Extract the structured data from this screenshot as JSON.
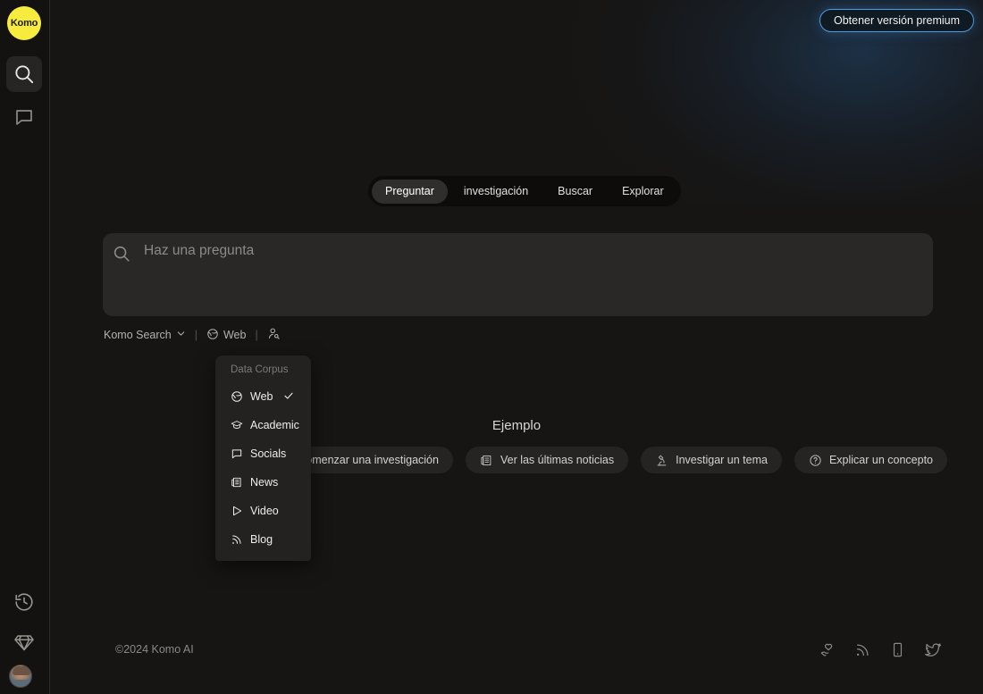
{
  "app": {
    "logo_text": "Komo",
    "copyright": "©2024 Komo AI"
  },
  "colors": {
    "background": "#171513",
    "sidebar": "#131211",
    "searchbox": "#2a2826",
    "accent_yellow": "#f7ec3d",
    "premium_border": "#4c9ddb",
    "dropdown_bg": "#232220"
  },
  "header": {
    "premium_button": "Obtener versión premium"
  },
  "sidebar": {
    "items": [
      {
        "name": "logo",
        "icon": "komo-logo-icon",
        "label": "Komo"
      },
      {
        "name": "search",
        "icon": "search-icon",
        "active": true
      },
      {
        "name": "chat",
        "icon": "chat-bubble-icon",
        "active": false
      },
      {
        "name": "history",
        "icon": "history-clock-icon",
        "active": false
      },
      {
        "name": "premium",
        "icon": "diamond-icon",
        "active": false
      },
      {
        "name": "profile",
        "icon": "avatar-icon",
        "active": false
      }
    ]
  },
  "tabs": [
    {
      "label": "Preguntar",
      "active": true
    },
    {
      "label": "investigación",
      "active": false
    },
    {
      "label": "Buscar",
      "active": false
    },
    {
      "label": "Explorar",
      "active": false
    }
  ],
  "search": {
    "placeholder": "Haz una pregunta",
    "value": "",
    "icon": "search-icon"
  },
  "controls": {
    "engine_label": "Komo Search",
    "engine_chevron": "chevron-down-icon",
    "divider": "|",
    "corpus_label": "Web",
    "corpus_icon": "globe-icon",
    "persona_icon": "person-search-icon"
  },
  "dropdown": {
    "title": "Data Corpus",
    "items": [
      {
        "label": "Web",
        "icon": "globe-icon",
        "selected": true
      },
      {
        "label": "Academic",
        "icon": "graduation-cap-icon",
        "selected": false
      },
      {
        "label": "Socials",
        "icon": "chat-bubble-icon",
        "selected": false
      },
      {
        "label": "News",
        "icon": "newspaper-icon",
        "selected": false
      },
      {
        "label": "Video",
        "icon": "play-triangle-icon",
        "selected": false
      },
      {
        "label": "Blog",
        "icon": "rss-icon",
        "selected": false
      }
    ],
    "check_glyph": "✓"
  },
  "examples": {
    "title": "Ejemplo",
    "chips": [
      {
        "label": "Comenzar una investigación",
        "icon": "compass-icon"
      },
      {
        "label": "Ver las últimas noticias",
        "icon": "newspaper-icon"
      },
      {
        "label": "Investigar un tema",
        "icon": "microscope-icon"
      },
      {
        "label": "Explicar un concepto",
        "icon": "question-circle-icon"
      }
    ]
  },
  "footer": {
    "copyright": "©2024 Komo AI",
    "icons": [
      {
        "name": "hand-heart-icon"
      },
      {
        "name": "rss-icon"
      },
      {
        "name": "mobile-phone-icon"
      },
      {
        "name": "twitter-icon"
      }
    ]
  }
}
